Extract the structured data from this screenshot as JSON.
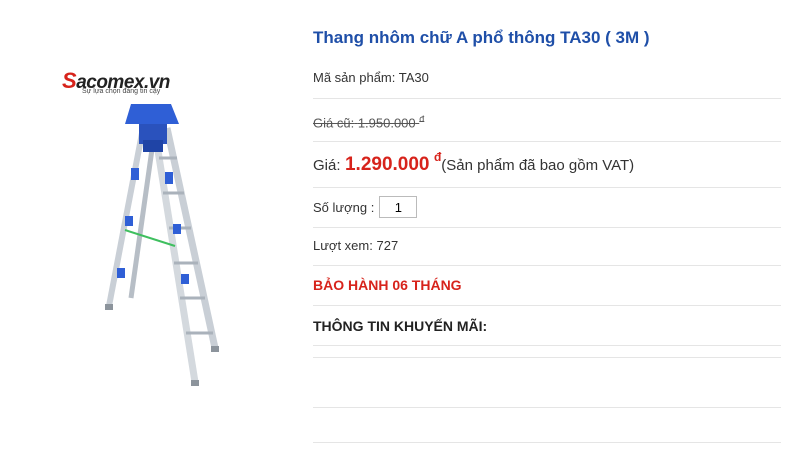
{
  "logo": {
    "brand_initial": "S",
    "brand_rest": "acomex.vn",
    "tagline": "Sự lựa chọn đáng tin cậy"
  },
  "product": {
    "title": "Thang nhôm chữ A phổ thông TA30 ( 3M )",
    "sku_label": "Mã sản phẩm:",
    "sku": "TA30",
    "old_price_label": "Giá cũ:",
    "old_price": "1.950.000",
    "currency_symbol": "đ",
    "price_label": "Giá:",
    "price": "1.290.000",
    "price_note": "(Sản phẩm đã bao gồm VAT)",
    "quantity_label": "Số lượng :",
    "quantity": "1",
    "views_label": "Lượt xem:",
    "views": "727",
    "warranty": "BẢO HÀNH 06 THÁNG",
    "promo_heading": "THÔNG TIN KHUYẾN MÃI:"
  },
  "colors": {
    "title": "#1f4fa8",
    "price": "#d7231b",
    "ladder_cap": "#2f5fd6",
    "ladder_rail": "#c9cfd6"
  }
}
